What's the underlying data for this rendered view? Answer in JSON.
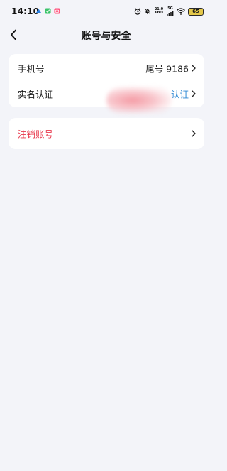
{
  "status_bar": {
    "time": "14:10",
    "net_speed_top": "21.0",
    "net_speed_bottom": "KB/s",
    "network_gen": "5G",
    "battery": "65",
    "icons": [
      "app-notification-icon-1",
      "app-notification-icon-2",
      "app-notification-icon-3",
      "alarm-icon",
      "mute-icon",
      "signal-icon",
      "wifi-icon",
      "battery-icon"
    ],
    "colors": {
      "notif1": "#2b7fe0",
      "notif2": "#3cc46b",
      "notif3": "#ff4f7a",
      "battery": "#e4c84a"
    }
  },
  "header": {
    "title": "账号与安全"
  },
  "account_card": {
    "rows": [
      {
        "label": "手机号",
        "value": "尾号 9186"
      },
      {
        "label": "实名认证",
        "value": "认证"
      }
    ]
  },
  "danger_card": {
    "rows": [
      {
        "label": "注销账号",
        "value": ""
      }
    ]
  },
  "colors": {
    "background": "#f3f4f9",
    "card": "#ffffff",
    "danger": "#e8394d",
    "link": "#2b87d3"
  }
}
